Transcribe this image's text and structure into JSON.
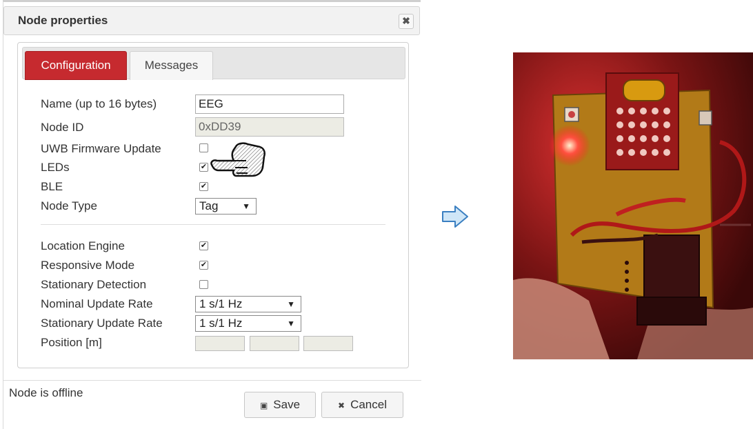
{
  "dialog": {
    "title": "Node properties",
    "close_symbol": "✖",
    "tabs": [
      {
        "label": "Configuration",
        "active": true
      },
      {
        "label": "Messages",
        "active": false
      }
    ],
    "fields": {
      "name_label": "Name (up to 16 bytes)",
      "name_value": "EEG",
      "node_id_label": "Node ID",
      "node_id_value": "0xDD39",
      "uwb_label": "UWB Firmware Update",
      "uwb_checked": false,
      "leds_label": "LEDs",
      "leds_checked": true,
      "ble_label": "BLE",
      "ble_checked": true,
      "node_type_label": "Node Type",
      "node_type_value": "Tag",
      "location_engine_label": "Location Engine",
      "location_engine_checked": true,
      "responsive_label": "Responsive Mode",
      "responsive_checked": true,
      "stationary_detection_label": "Stationary Detection",
      "stationary_detection_checked": false,
      "nominal_rate_label": "Nominal Update Rate",
      "nominal_rate_value": "1 s/1 Hz",
      "stationary_rate_label": "Stationary Update Rate",
      "stationary_rate_value": "1 s/1 Hz",
      "position_label": "Position [m]"
    },
    "status": "Node is offline",
    "buttons": {
      "save_label": "Save",
      "cancel_label": "Cancel"
    }
  },
  "colors": {
    "accent": "#c62a2f",
    "arrow_fill": "#cfe6f7",
    "arrow_stroke": "#3a7fc1"
  },
  "icons": [
    "close-icon",
    "pointing-hand-icon",
    "save-icon",
    "cancel-icon",
    "right-arrow-icon",
    "dropdown-arrow-icon"
  ]
}
